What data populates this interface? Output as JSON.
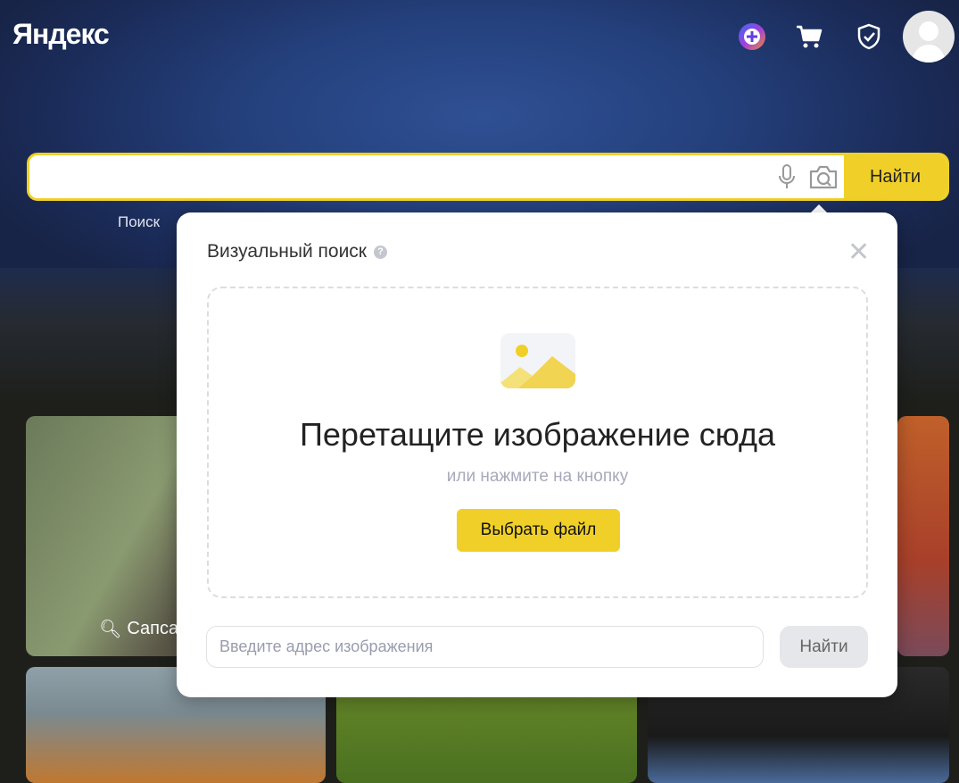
{
  "header": {
    "logo": "Яндекс",
    "icons": [
      "plus-icon",
      "cart-icon",
      "shield-icon",
      "avatar"
    ]
  },
  "search": {
    "value": "",
    "placeholder": "",
    "button": "Найти",
    "icons": [
      "microphone-icon",
      "camera-icon"
    ]
  },
  "below_search": {
    "link": "Поиск"
  },
  "visual_search": {
    "title": "Визуальный поиск",
    "help": "?",
    "drop_title": "Перетащите изображение сюда",
    "drop_subtitle": "или нажмите на кнопку",
    "choose_file": "Выбрать файл",
    "url_placeholder": "Введите адрес изображения",
    "url_button": "Найти"
  },
  "tiles": [
    {
      "label": "Сапса"
    }
  ],
  "colors": {
    "accent": "#f0d028",
    "background": "#24407c"
  }
}
